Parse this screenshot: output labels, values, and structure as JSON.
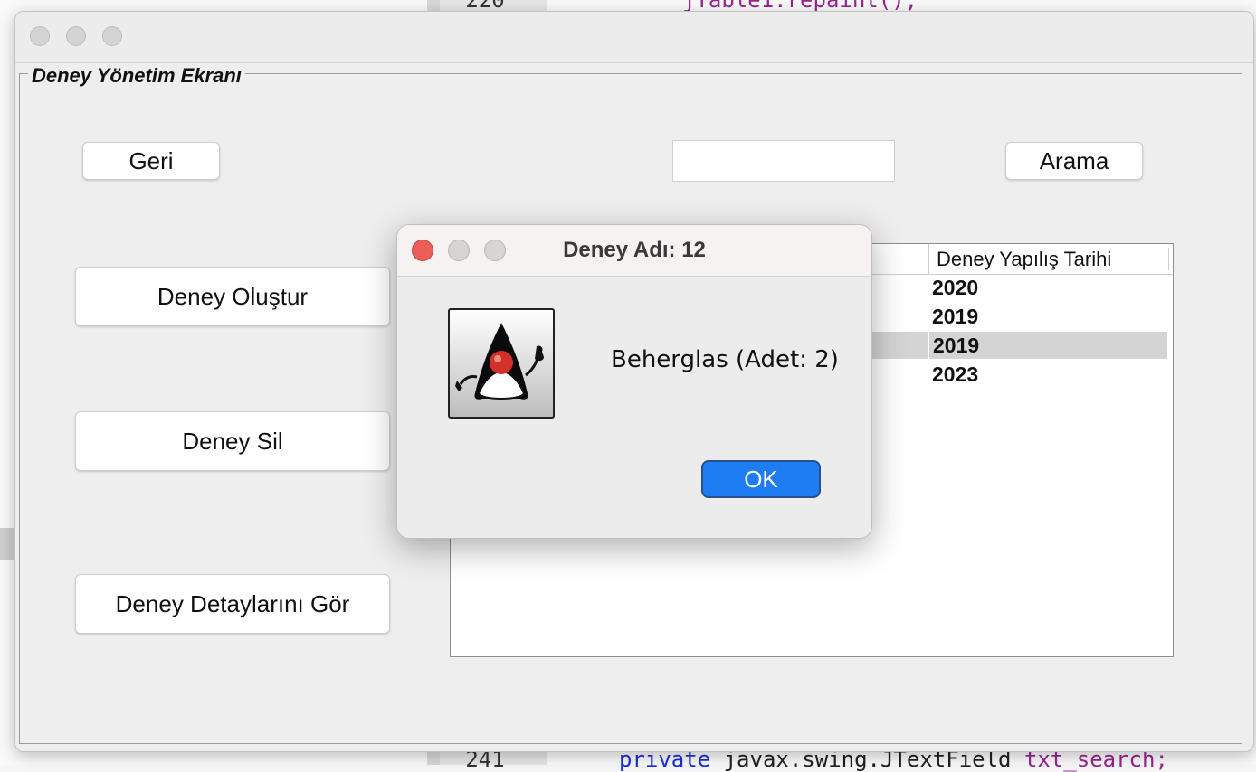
{
  "background_editor": {
    "top_code": "jTable1.repaint();",
    "top_line_number": "220",
    "bottom_line_number": "241",
    "bottom_code_keyword": "private",
    "bottom_code_type": "javax.swing.JTextField",
    "bottom_code_var": "txt_search;"
  },
  "main_window": {
    "panel_title": "Deney Yönetim Ekranı",
    "back_button": "Geri",
    "search_input_value": "",
    "search_button": "Arama",
    "create_button": "Deney Oluştur",
    "delete_button": "Deney Sil",
    "details_button": "Deney Detaylarını Gör",
    "table": {
      "columns": [
        "Deney Yapılış Tarihi"
      ],
      "rows": [
        {
          "date": "2020",
          "selected": false
        },
        {
          "date": "2019",
          "selected": false
        },
        {
          "date": "2019",
          "selected": true
        },
        {
          "date": "2023",
          "selected": false
        }
      ]
    }
  },
  "dialog": {
    "title": "Deney Adı: 12",
    "message": "Beherglas (Adet: 2)",
    "ok_button": "OK",
    "icon": "java-duke-icon"
  },
  "colors": {
    "close_light": "#ec5f58",
    "ok_button": "#1f7df4",
    "selection": "#d4d4d4"
  }
}
